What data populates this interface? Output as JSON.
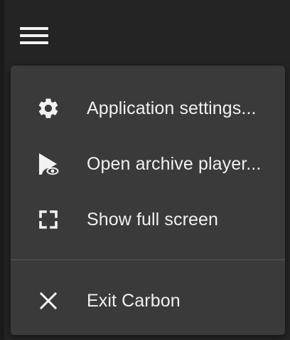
{
  "header": {
    "menu_icon": "hamburger-menu-icon"
  },
  "menu": {
    "items": [
      {
        "label": "Application settings...",
        "icon": "gear-icon"
      },
      {
        "label": "Open archive player...",
        "icon": "play-archive-icon"
      },
      {
        "label": "Show full screen",
        "icon": "fullscreen-icon"
      }
    ],
    "exit": {
      "label": "Exit Carbon",
      "icon": "close-icon"
    }
  },
  "colors": {
    "background": "#242424",
    "menu_background": "#3a3a3a",
    "text": "#f0f0f0",
    "divider": "#555555"
  }
}
